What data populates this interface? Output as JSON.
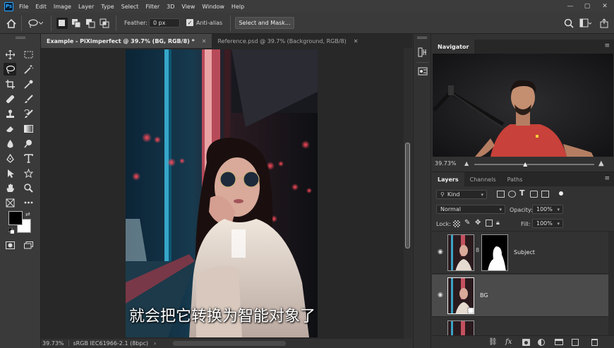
{
  "app": {
    "logo": "Ps"
  },
  "menu": [
    "File",
    "Edit",
    "Image",
    "Layer",
    "Type",
    "Select",
    "Filter",
    "3D",
    "View",
    "Window",
    "Help"
  ],
  "window_controls": {
    "minimize": "—",
    "restore": "▢",
    "close": "✕"
  },
  "options_bar": {
    "feather_label": "Feather:",
    "feather_value": "0 px",
    "antialias_label": "Anti-alias",
    "antialias_checked": true,
    "select_mask_label": "Select and Mask..."
  },
  "tabs": [
    {
      "label": "Example - PiXimperfect @ 39.7% (BG, RGB/8) *",
      "close": "✕",
      "active": true
    },
    {
      "label": "Reference.psd @ 39.7% (Background, RGB/8)",
      "close": "✕",
      "active": false
    }
  ],
  "subtitle": "就会把它转换为智能对象了",
  "status": {
    "zoom": "39.73%",
    "profile": "sRGB IEC61966-2.1 (8bpc)",
    "arrow": "›"
  },
  "navigator": {
    "tab": "Navigator",
    "zoom": "39.73%",
    "zoom_fraction": 0.43
  },
  "layers_panel": {
    "tabs": [
      "Layers",
      "Channels",
      "Paths"
    ],
    "filter_kind": "Kind",
    "blend_mode": "Normal",
    "opacity_label": "Opacity:",
    "opacity_value": "100%",
    "lock_label": "Lock:",
    "fill_label": "Fill:",
    "fill_value": "100%",
    "layers": [
      {
        "name": "Subject",
        "visible": true,
        "selected": false,
        "has_mask": true
      },
      {
        "name": "BG",
        "visible": true,
        "selected": true,
        "has_mask": false
      },
      {
        "name": "",
        "visible": true,
        "selected": false,
        "has_mask": false
      }
    ],
    "bottom_icons": [
      "link-icon",
      "fx-icon",
      "mask-icon",
      "adjustment-icon",
      "group-icon",
      "new-layer-icon",
      "trash-icon"
    ],
    "fx_label": "fx"
  },
  "colors": {
    "accent": "#31a8ff",
    "panel": "#323232",
    "selected_layer": "#4b4b4b"
  }
}
